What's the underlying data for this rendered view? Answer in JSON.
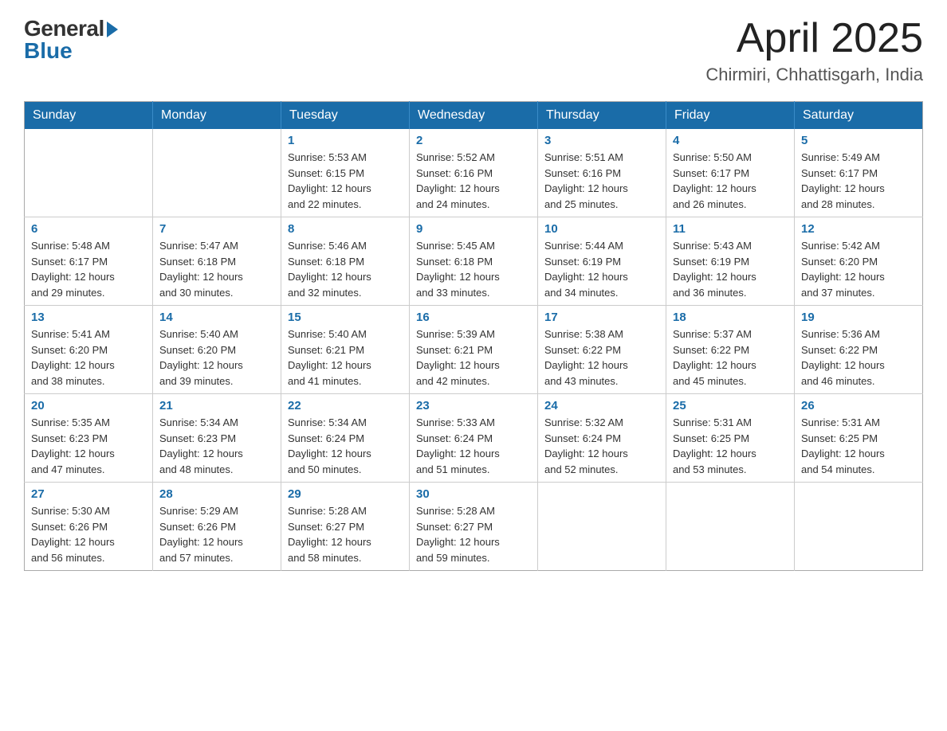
{
  "header": {
    "logo": {
      "general": "General",
      "blue": "Blue"
    },
    "title": "April 2025",
    "location": "Chirmiri, Chhattisgarh, India"
  },
  "calendar": {
    "days": [
      "Sunday",
      "Monday",
      "Tuesday",
      "Wednesday",
      "Thursday",
      "Friday",
      "Saturday"
    ],
    "weeks": [
      {
        "cells": [
          {
            "day": "",
            "info": ""
          },
          {
            "day": "",
            "info": ""
          },
          {
            "day": "1",
            "info": "Sunrise: 5:53 AM\nSunset: 6:15 PM\nDaylight: 12 hours\nand 22 minutes."
          },
          {
            "day": "2",
            "info": "Sunrise: 5:52 AM\nSunset: 6:16 PM\nDaylight: 12 hours\nand 24 minutes."
          },
          {
            "day": "3",
            "info": "Sunrise: 5:51 AM\nSunset: 6:16 PM\nDaylight: 12 hours\nand 25 minutes."
          },
          {
            "day": "4",
            "info": "Sunrise: 5:50 AM\nSunset: 6:17 PM\nDaylight: 12 hours\nand 26 minutes."
          },
          {
            "day": "5",
            "info": "Sunrise: 5:49 AM\nSunset: 6:17 PM\nDaylight: 12 hours\nand 28 minutes."
          }
        ]
      },
      {
        "cells": [
          {
            "day": "6",
            "info": "Sunrise: 5:48 AM\nSunset: 6:17 PM\nDaylight: 12 hours\nand 29 minutes."
          },
          {
            "day": "7",
            "info": "Sunrise: 5:47 AM\nSunset: 6:18 PM\nDaylight: 12 hours\nand 30 minutes."
          },
          {
            "day": "8",
            "info": "Sunrise: 5:46 AM\nSunset: 6:18 PM\nDaylight: 12 hours\nand 32 minutes."
          },
          {
            "day": "9",
            "info": "Sunrise: 5:45 AM\nSunset: 6:18 PM\nDaylight: 12 hours\nand 33 minutes."
          },
          {
            "day": "10",
            "info": "Sunrise: 5:44 AM\nSunset: 6:19 PM\nDaylight: 12 hours\nand 34 minutes."
          },
          {
            "day": "11",
            "info": "Sunrise: 5:43 AM\nSunset: 6:19 PM\nDaylight: 12 hours\nand 36 minutes."
          },
          {
            "day": "12",
            "info": "Sunrise: 5:42 AM\nSunset: 6:20 PM\nDaylight: 12 hours\nand 37 minutes."
          }
        ]
      },
      {
        "cells": [
          {
            "day": "13",
            "info": "Sunrise: 5:41 AM\nSunset: 6:20 PM\nDaylight: 12 hours\nand 38 minutes."
          },
          {
            "day": "14",
            "info": "Sunrise: 5:40 AM\nSunset: 6:20 PM\nDaylight: 12 hours\nand 39 minutes."
          },
          {
            "day": "15",
            "info": "Sunrise: 5:40 AM\nSunset: 6:21 PM\nDaylight: 12 hours\nand 41 minutes."
          },
          {
            "day": "16",
            "info": "Sunrise: 5:39 AM\nSunset: 6:21 PM\nDaylight: 12 hours\nand 42 minutes."
          },
          {
            "day": "17",
            "info": "Sunrise: 5:38 AM\nSunset: 6:22 PM\nDaylight: 12 hours\nand 43 minutes."
          },
          {
            "day": "18",
            "info": "Sunrise: 5:37 AM\nSunset: 6:22 PM\nDaylight: 12 hours\nand 45 minutes."
          },
          {
            "day": "19",
            "info": "Sunrise: 5:36 AM\nSunset: 6:22 PM\nDaylight: 12 hours\nand 46 minutes."
          }
        ]
      },
      {
        "cells": [
          {
            "day": "20",
            "info": "Sunrise: 5:35 AM\nSunset: 6:23 PM\nDaylight: 12 hours\nand 47 minutes."
          },
          {
            "day": "21",
            "info": "Sunrise: 5:34 AM\nSunset: 6:23 PM\nDaylight: 12 hours\nand 48 minutes."
          },
          {
            "day": "22",
            "info": "Sunrise: 5:34 AM\nSunset: 6:24 PM\nDaylight: 12 hours\nand 50 minutes."
          },
          {
            "day": "23",
            "info": "Sunrise: 5:33 AM\nSunset: 6:24 PM\nDaylight: 12 hours\nand 51 minutes."
          },
          {
            "day": "24",
            "info": "Sunrise: 5:32 AM\nSunset: 6:24 PM\nDaylight: 12 hours\nand 52 minutes."
          },
          {
            "day": "25",
            "info": "Sunrise: 5:31 AM\nSunset: 6:25 PM\nDaylight: 12 hours\nand 53 minutes."
          },
          {
            "day": "26",
            "info": "Sunrise: 5:31 AM\nSunset: 6:25 PM\nDaylight: 12 hours\nand 54 minutes."
          }
        ]
      },
      {
        "cells": [
          {
            "day": "27",
            "info": "Sunrise: 5:30 AM\nSunset: 6:26 PM\nDaylight: 12 hours\nand 56 minutes."
          },
          {
            "day": "28",
            "info": "Sunrise: 5:29 AM\nSunset: 6:26 PM\nDaylight: 12 hours\nand 57 minutes."
          },
          {
            "day": "29",
            "info": "Sunrise: 5:28 AM\nSunset: 6:27 PM\nDaylight: 12 hours\nand 58 minutes."
          },
          {
            "day": "30",
            "info": "Sunrise: 5:28 AM\nSunset: 6:27 PM\nDaylight: 12 hours\nand 59 minutes."
          },
          {
            "day": "",
            "info": ""
          },
          {
            "day": "",
            "info": ""
          },
          {
            "day": "",
            "info": ""
          }
        ]
      }
    ]
  }
}
